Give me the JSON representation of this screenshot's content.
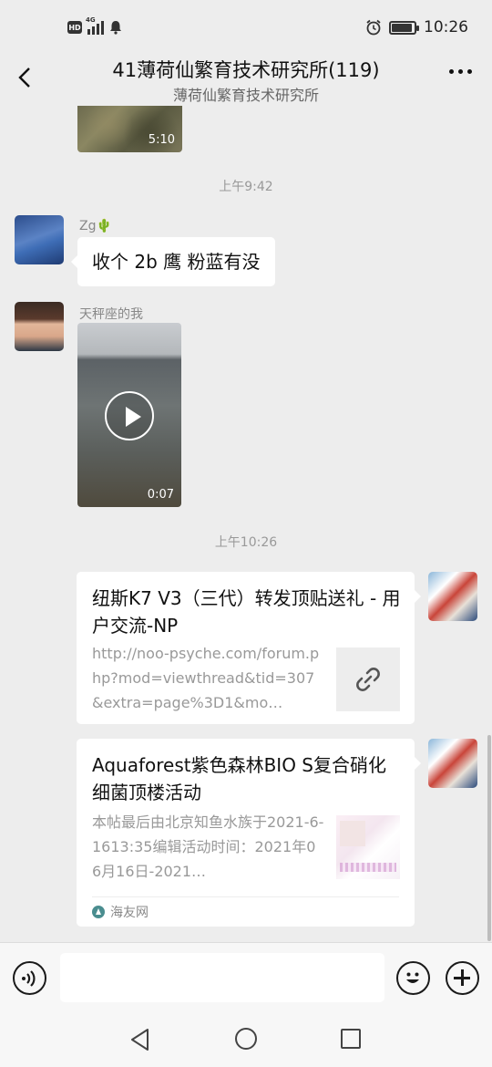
{
  "status_bar": {
    "hd": "HD",
    "network": "4G",
    "time": "10:26",
    "battery_level": 0.85
  },
  "header": {
    "title": "41薄荷仙繁育技术研究所(119)",
    "subtitle": "薄荷仙繁育技术研究所"
  },
  "messages": {
    "top_video": {
      "duration": "5:10"
    },
    "timestamp_1": "上午9:42",
    "msg_zg": {
      "sender": "Zg🌵",
      "text": "收个 2b 鹰 粉蓝有没"
    },
    "msg_tianping": {
      "sender": "天秤座的我",
      "duration": "0:07"
    },
    "timestamp_2": "上午10:26",
    "card_1": {
      "title": "纽斯K7 V3（三代）转发顶贴送礼 - 用户交流-NP",
      "description": "http://noo-psyche.com/forum.php?mod=viewthread&tid=307&extra=page%3D1&mo…"
    },
    "card_2": {
      "title": "Aquaforest紫色森林BIO S复合硝化细菌顶楼活动",
      "description": "本帖最后由北京知鱼水族于2021-6-1613:35编辑活动时间：2021年06月16日-2021…",
      "source": "海友网"
    }
  },
  "input_bar": {
    "placeholder": ""
  },
  "icons": {
    "back": "back-arrow-icon",
    "more": "more-dots-icon",
    "voice": "voice-icon",
    "emoji": "emoji-icon",
    "plus": "plus-icon",
    "link": "link-icon"
  }
}
